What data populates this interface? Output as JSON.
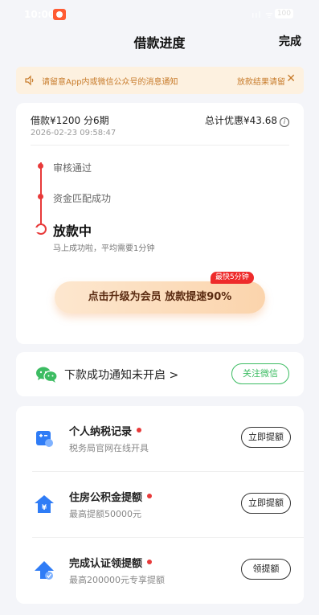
{
  "status_bar": {
    "time": "10:00",
    "signal": "ııl ᯤ",
    "battery": "100"
  },
  "nav": {
    "title": "借款进度",
    "done_label": "完成"
  },
  "notice": {
    "message": "请留意App内或微信公众号的消息通知",
    "result": "放款结果请留",
    "accent_color": "#c77a29",
    "background_color": "#fdf1e0"
  },
  "loan": {
    "amount_terms": "借款¥1200  分6期",
    "date": "2026-02-23 09:58:47",
    "discount": "总计优惠¥43.68",
    "steps": [
      {
        "label": "审核通过"
      },
      {
        "label": "资金匹配成功"
      }
    ],
    "current_step": "放款中",
    "current_step_sub": "马上成功啦，平均需要1分钟",
    "upgrade_button": "点击升级为会员 放款提速90%",
    "upgrade_badge": "最快5分钟",
    "accent_color": "#e83a3a"
  },
  "wechat": {
    "text": "下款成功通知未开启 >",
    "button": "关注微信",
    "color": "#3cbc62"
  },
  "services": [
    {
      "icon": "tax-record-icon",
      "title": "个人纳税记录",
      "subtitle": "税务局官网在线开具",
      "button": "立即提额"
    },
    {
      "icon": "housing-fund-icon",
      "title": "住房公积金提额",
      "subtitle": "最高提额50000元",
      "button": "立即提额"
    },
    {
      "icon": "verify-upgrade-icon",
      "title": "完成认证领提额",
      "subtitle": "最高200000元专享提额",
      "button": "领提额"
    }
  ]
}
